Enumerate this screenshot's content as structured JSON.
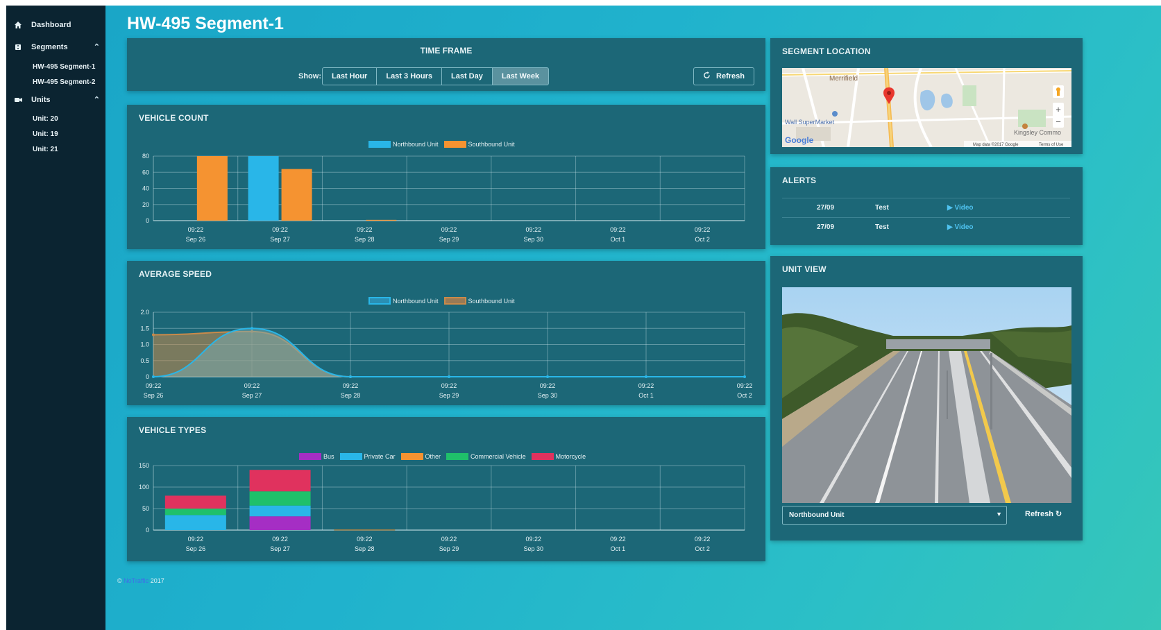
{
  "sidebar": {
    "dashboard": "Dashboard",
    "segments": "Segments",
    "segment_items": [
      "HW-495 Segment-1",
      "HW-495 Segment-2"
    ],
    "units": "Units",
    "unit_items": [
      "Unit: 20",
      "Unit: 19",
      "Unit: 21"
    ]
  },
  "page": {
    "title": "HW-495 Segment-1"
  },
  "timeframe": {
    "title": "TIME FRAME",
    "show_label": "Show:",
    "options": [
      "Last Hour",
      "Last 3 Hours",
      "Last Day",
      "Last Week"
    ],
    "selected": "Last Week",
    "refresh_label": "Refresh"
  },
  "vehicle_count": {
    "title": "VEHICLE COUNT",
    "chart_data": {
      "type": "bar",
      "categories": [
        "09:22 Sep 26",
        "09:22 Sep 27",
        "09:22 Sep 28",
        "09:22 Sep 29",
        "09:22 Sep 30",
        "09:22 Oct 1",
        "09:22 Oct 2"
      ],
      "tick_times": [
        "09:22",
        "09:22",
        "09:22",
        "09:22",
        "09:22",
        "09:22",
        "09:22"
      ],
      "tick_dates": [
        "Sep 26",
        "Sep 27",
        "Sep 28",
        "Sep 29",
        "Sep 30",
        "Oct 1",
        "Oct 2"
      ],
      "series": [
        {
          "name": "Northbound Unit",
          "color": "#29b6e8",
          "values": [
            0,
            80,
            0,
            0,
            0,
            0,
            0
          ]
        },
        {
          "name": "Southbound Unit",
          "color": "#f59331",
          "values": [
            80,
            64,
            1,
            0,
            0,
            0,
            0
          ]
        }
      ],
      "ylim": [
        0,
        80
      ],
      "yticks": [
        0,
        20,
        40,
        60,
        80
      ],
      "grid": true,
      "legend": "top-center"
    }
  },
  "average_speed": {
    "title": "AVERAGE SPEED",
    "chart_data": {
      "type": "area",
      "x": [
        "09:22 Sep 26",
        "09:22 Sep 27",
        "09:22 Sep 28",
        "09:22 Sep 29",
        "09:22 Sep 30",
        "09:22 Oct 1",
        "09:22 Oct 2"
      ],
      "tick_times": [
        "09:22",
        "09:22",
        "09:22",
        "09:22",
        "09:22",
        "09:22",
        "09:22"
      ],
      "tick_dates": [
        "Sep 26",
        "Sep 27",
        "Sep 28",
        "Sep 29",
        "Sep 30",
        "Oct 1",
        "Oct 2"
      ],
      "series": [
        {
          "name": "Northbound Unit",
          "color": "#29b6e8",
          "values": [
            0,
            1.5,
            0,
            0,
            0,
            0,
            0
          ]
        },
        {
          "name": "Southbound Unit",
          "color": "#c98a4a",
          "values": [
            1.3,
            1.4,
            0,
            null,
            null,
            null,
            null
          ]
        }
      ],
      "ylim": [
        0,
        2.0
      ],
      "yticks": [
        "0",
        "0.5",
        "1.0",
        "1.5",
        "2.0"
      ],
      "grid": true,
      "legend": "top-center"
    }
  },
  "vehicle_types": {
    "title": "VEHICLE TYPES",
    "chart_data": {
      "type": "bar",
      "stacked": true,
      "categories": [
        "09:22 Sep 26",
        "09:22 Sep 27",
        "09:22 Sep 28",
        "09:22 Sep 29",
        "09:22 Sep 30",
        "09:22 Oct 1",
        "09:22 Oct 2"
      ],
      "tick_times": [
        "09:22",
        "09:22",
        "09:22",
        "09:22",
        "09:22",
        "09:22",
        "09:22"
      ],
      "tick_dates": [
        "Sep 26",
        "Sep 27",
        "Sep 28",
        "Sep 29",
        "Sep 30",
        "Oct 1",
        "Oct 2"
      ],
      "series": [
        {
          "name": "Bus",
          "color": "#a52ec4",
          "values": [
            0,
            32,
            0,
            0,
            0,
            0,
            0
          ]
        },
        {
          "name": "Private Car",
          "color": "#29b6e8",
          "values": [
            35,
            25,
            0,
            0,
            0,
            0,
            0
          ]
        },
        {
          "name": "Other",
          "color": "#f59331",
          "values": [
            0,
            0,
            1,
            0,
            0,
            0,
            0
          ]
        },
        {
          "name": "Commercial Vehicle",
          "color": "#1fc06a",
          "values": [
            15,
            33,
            0,
            0,
            0,
            0,
            0
          ]
        },
        {
          "name": "Motorcycle",
          "color": "#e0325e",
          "values": [
            30,
            50,
            0,
            0,
            0,
            0,
            0
          ]
        }
      ],
      "ylim": [
        0,
        150
      ],
      "yticks": [
        0,
        50,
        100,
        150
      ],
      "grid": true,
      "legend": "top-center"
    }
  },
  "segment_location": {
    "title": "SEGMENT LOCATION",
    "map_labels": {
      "town": "Merrifield",
      "store": "Wall SuperMarket",
      "area": "Kingsley Commo",
      "google": "Google",
      "attribution": "Map data ©2017 Google",
      "terms": "Terms of Use",
      "zoom_in": "+",
      "zoom_out": "−"
    }
  },
  "alerts": {
    "title": "ALERTS",
    "rows": [
      {
        "date": "27/09",
        "type": "Test",
        "link": "Video"
      },
      {
        "date": "27/09",
        "type": "Test",
        "link": "Video"
      }
    ]
  },
  "unit_view": {
    "title": "UNIT VIEW",
    "selected_unit": "Northbound Unit",
    "refresh_label": "Refresh"
  },
  "footer": {
    "prefix": "©",
    "brand": "NoTraffic",
    "year": "2017"
  }
}
